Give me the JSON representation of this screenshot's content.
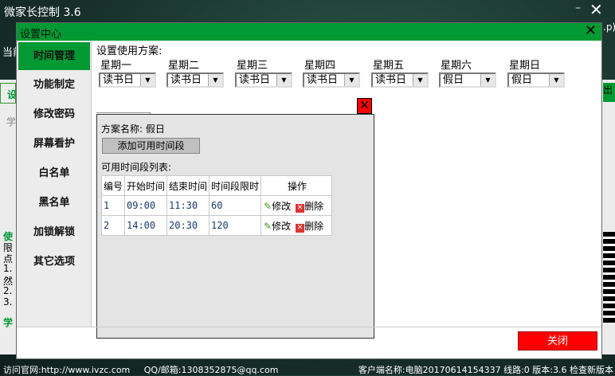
{
  "app": {
    "title": "微家长控制 3.6",
    "minimize": "–",
    "close": "✕"
  },
  "background_fragments": {
    "current": "当前",
    "settings_tab": "设",
    "study": "学",
    "usage": "使",
    "limit": "限",
    "click": "点",
    "l1": "1.",
    "then": "然",
    "l2": "2.",
    "l3": "3.",
    "study2": "学",
    "right_p": ".p)",
    "right_tab": "出"
  },
  "dialog": {
    "title": "设置中心",
    "close": "✕",
    "sidebar": [
      {
        "label": "时间管理",
        "active": true
      },
      {
        "label": "功能制定"
      },
      {
        "label": "修改密码"
      },
      {
        "label": "屏幕看护"
      },
      {
        "label": "白名单"
      },
      {
        "label": "黑名单"
      },
      {
        "label": "加锁解锁"
      },
      {
        "label": "其它选项"
      }
    ],
    "plan_label": "设置使用方案:",
    "days": [
      {
        "label": "星期一",
        "value": "读书日"
      },
      {
        "label": "星期二",
        "value": "读书日"
      },
      {
        "label": "星期三",
        "value": "读书日"
      },
      {
        "label": "星期四",
        "value": "读书日"
      },
      {
        "label": "星期五",
        "value": "读书日"
      },
      {
        "label": "星期六",
        "value": "假日"
      },
      {
        "label": "星期日",
        "value": "假日"
      }
    ],
    "panel_close": "✕",
    "panel": {
      "name_label": "方案名称:",
      "name_value": "假日",
      "add_button": "添加可用时间段",
      "list_label": "可用时间段列表:",
      "columns": [
        "编号",
        "开始时间",
        "结束时间",
        "时间段限时",
        "操作"
      ],
      "rows": [
        {
          "id": "1",
          "start": "09:00",
          "end": "11:30",
          "limit": "60"
        },
        {
          "id": "2",
          "start": "14:00",
          "end": "20:30",
          "limit": "120"
        }
      ],
      "edit": "修改",
      "delete": "删除"
    },
    "close_button": "关闭"
  },
  "status": {
    "website": "访问官网:http://www.ivzc.com",
    "contact": "QQ/邮箱:1308352875@qq.com",
    "client": "客户端名称:电脑20170614154337",
    "line": "线路:0",
    "version": "版本:3.6",
    "check": "检查新版本"
  }
}
